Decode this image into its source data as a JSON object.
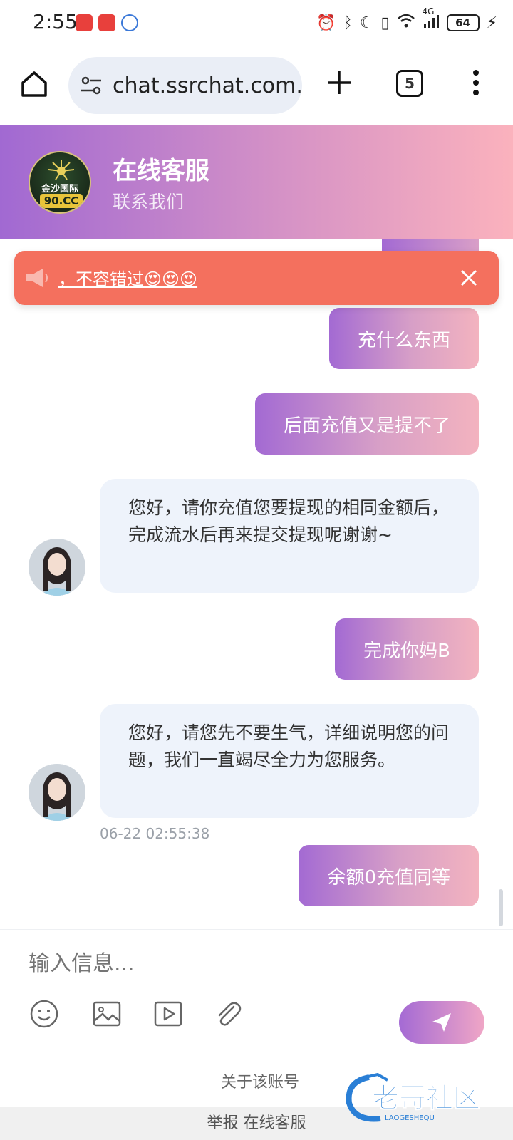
{
  "status_bar": {
    "time": "2:55",
    "battery": "64",
    "network": "4G"
  },
  "browser": {
    "url": "chat.ssrchat.com.",
    "tab_count": "5"
  },
  "header": {
    "title": "在线客服",
    "subtitle": "联系我们",
    "logo_text_top": "金沙国际",
    "logo_text_bottom": "90.CC"
  },
  "notice": {
    "text": "，不容错过😍😍😍"
  },
  "messages": [
    {
      "from": "user",
      "text": "充什么东西"
    },
    {
      "from": "user",
      "text": "后面充值又是提不了"
    },
    {
      "from": "agent",
      "text": "您好，请你充值您要提现的相同金额后，完成流水后再来提交提现呢谢谢~"
    },
    {
      "from": "user",
      "text": "完成你妈B"
    },
    {
      "from": "agent",
      "text": "您好，请您先不要生气，详细说明您的问题，我们一直竭尽全力为您服务。",
      "timestamp": "06-22 02:55:38"
    },
    {
      "from": "user",
      "text": "余额0充值同等"
    }
  ],
  "composer": {
    "placeholder": "输入信息..."
  },
  "footer": {
    "about": "关于该账号",
    "report": "举报 在线客服"
  },
  "watermark": {
    "text": "老哥社区",
    "subtext": "LAOGESHEQU"
  },
  "colors": {
    "header_gradient_start": "#a169d2",
    "header_gradient_end": "#fbb2bd",
    "notice_bg": "#f4705e",
    "agent_bubble": "#eef3fb"
  }
}
